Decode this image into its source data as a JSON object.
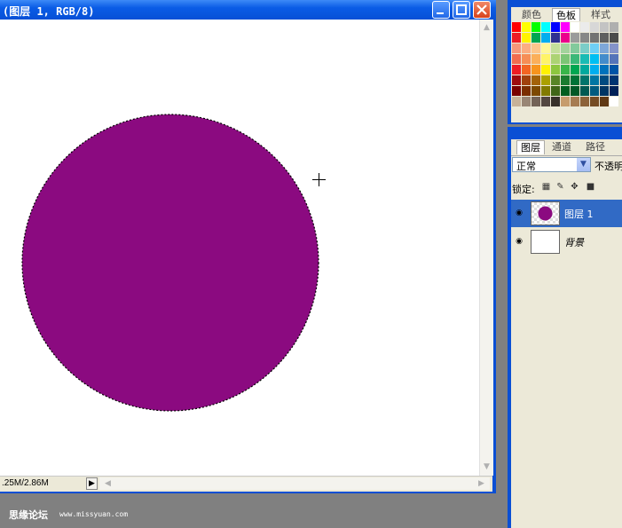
{
  "document": {
    "title": "(图层 1, RGB/8)",
    "status": ".25M/2.86M",
    "fill_color": "#8b0a80"
  },
  "swatches": {
    "tabs": [
      "颜色",
      "色板",
      "样式"
    ],
    "active_tab": "色板"
  },
  "layers": {
    "tabs": [
      "图层",
      "通道",
      "路径"
    ],
    "blend_mode": "正常",
    "opacity_label": "不透明",
    "lock_label": "锁定:",
    "items": [
      {
        "name": "图层 1",
        "selected": true
      },
      {
        "name": "背景",
        "selected": false
      }
    ]
  },
  "watermark": {
    "text": "思缘论坛",
    "url": "www.missyuan.com"
  }
}
